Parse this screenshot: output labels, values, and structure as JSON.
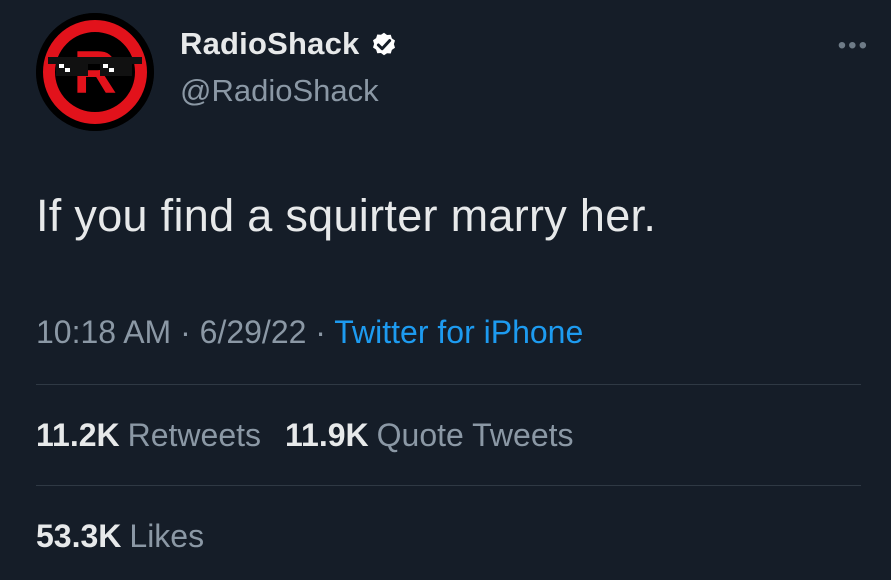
{
  "profile": {
    "display_name": "RadioShack",
    "handle": "@RadioShack",
    "verified": true,
    "avatar_letter": "R"
  },
  "menu": {
    "more_label": "•••"
  },
  "tweet": {
    "text": "If you find a squirter marry her."
  },
  "meta": {
    "time": "10:18 AM",
    "sep1": " · ",
    "date": "6/29/22",
    "sep2": " · ",
    "source": "Twitter for iPhone"
  },
  "stats": {
    "retweets": {
      "value": "11.2K",
      "label": "Retweets"
    },
    "quote_tweets": {
      "value": "11.9K",
      "label": "Quote Tweets"
    },
    "likes": {
      "value": "53.3K",
      "label": "Likes"
    }
  },
  "colors": {
    "background": "#151d28",
    "link": "#1d9bf0",
    "secondary_text": "#8b98a5",
    "brand_red": "#e2121b"
  }
}
